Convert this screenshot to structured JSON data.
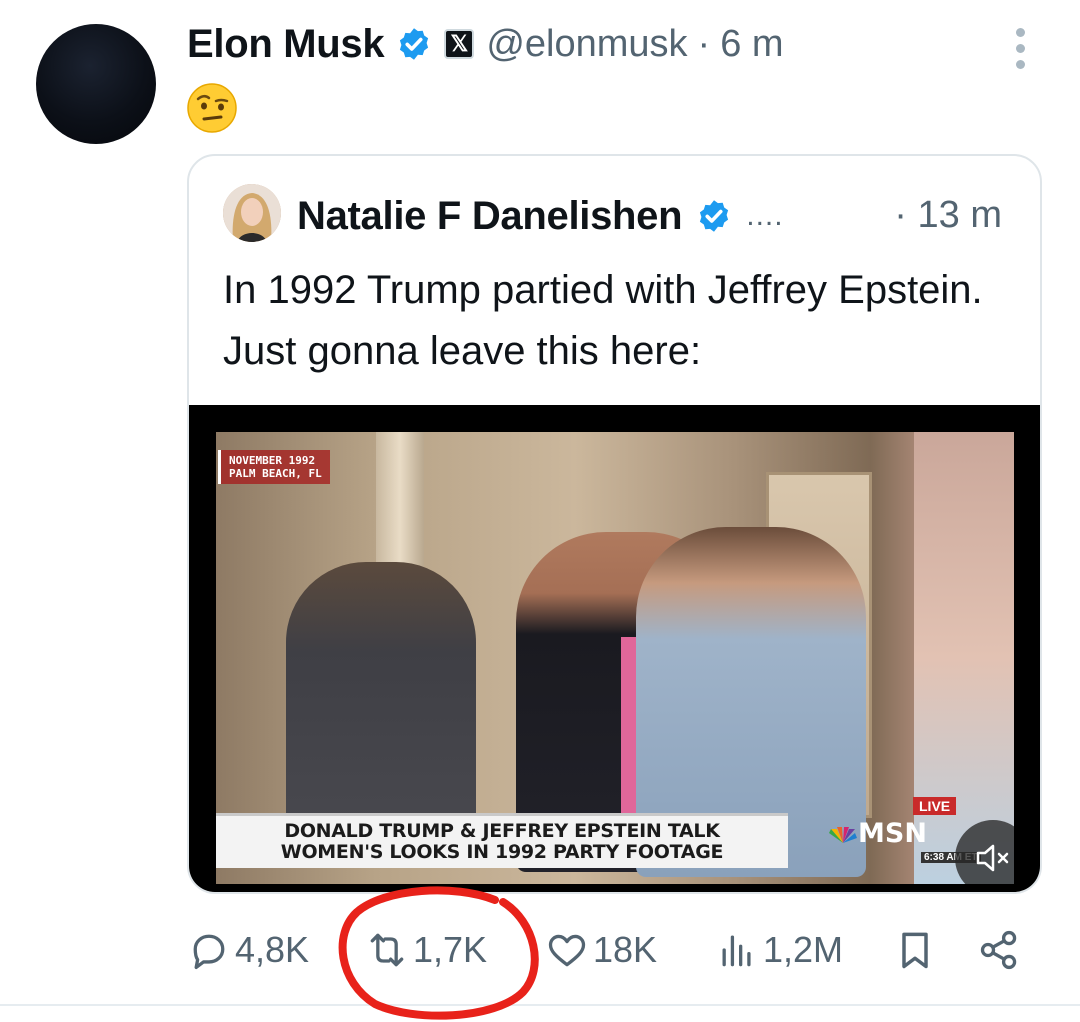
{
  "tweet": {
    "author_name": "Elon Musk",
    "handle": "@elonmusk",
    "separator": "·",
    "time": "6 m",
    "emoji": "🤨",
    "colors": {
      "verified": "#1d9bf0",
      "secondary_text": "#536471",
      "annotation": "#e8221a"
    }
  },
  "quote": {
    "author_name": "Natalie F Danelishen",
    "ellipsis": "....",
    "time": "· 13 m",
    "text": "In 1992 Trump partied with Jeffrey Epstein. Just gonna leave this here:",
    "video": {
      "bug_line1": "NOVEMBER 1992",
      "bug_line2": "PALM BEACH, FL",
      "chyron_line1": "DONALD TRUMP & JEFFREY EPSTEIN TALK",
      "chyron_line2": "WOMEN'S LOOKS IN 1992 PARTY FOOTAGE",
      "live_label": "LIVE",
      "network": "MSN",
      "clock": "6:38 AM ET"
    }
  },
  "actions": {
    "replies": "4,8K",
    "reposts": "1,7K",
    "likes": "18K",
    "views": "1,2M"
  }
}
